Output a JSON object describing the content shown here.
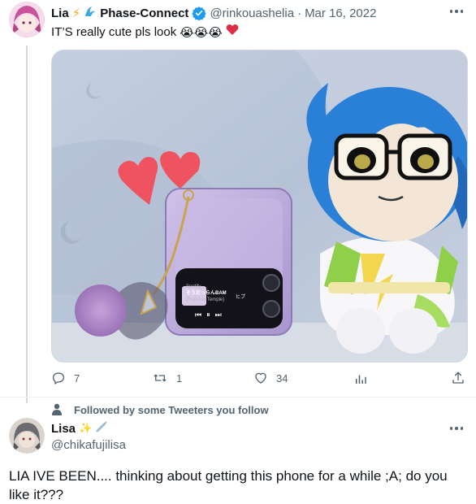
{
  "tweet": {
    "display_name": "Lia",
    "handle": "@rinkouashelia",
    "date": "Mar 16, 2022",
    "org_label": "Phase-Connect",
    "text": "IT’S really cute pls look",
    "emojis": "😭😭😭",
    "verified_color": "#1d9bf0",
    "image": {
      "phone_label_top": "Spotify",
      "phone_song_title": "そうだっらんBAM",
      "phone_song_artist": "(Red Ass Temple)",
      "phone_extra": "ヒプ"
    },
    "actions": {
      "reply_count": "7",
      "retweet_count": "1",
      "like_count": "34"
    }
  },
  "social_context": "Followed by some Tweeters you follow",
  "reply": {
    "display_name": "Lisa",
    "handle": "@chikafujilisa",
    "text": "LIA IVE BEEN.... thinking about getting this phone for a while ;A; do you like it???"
  },
  "colors": {
    "accent": "#1d9bf0",
    "text": "#0f1419",
    "muted": "#536471",
    "heart": "#e0245e"
  }
}
